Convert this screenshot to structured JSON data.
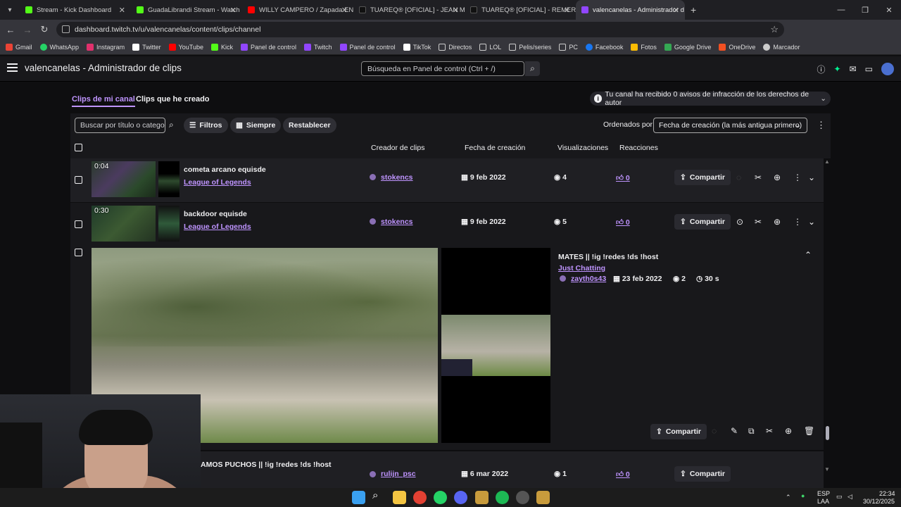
{
  "browser": {
    "tabs": [
      {
        "title": "Stream - Kick Dashboard",
        "color": "#53fc18"
      },
      {
        "title": "GuadaLibrandi Stream - Watch",
        "color": "#53fc18"
      },
      {
        "title": "WILLY CAMPERO / Zapada EN",
        "color": "#ff0000"
      },
      {
        "title": "TUAREQ® [OFICIAL] - JEAN M",
        "color": "#111111"
      },
      {
        "title": "TUAREQ® [OFICIAL] - REMERA",
        "color": "#111111"
      },
      {
        "title": "valencanelas - Administrador d",
        "color": "#9146ff"
      }
    ],
    "url": "dashboard.twitch.tv/u/valencanelas/content/clips/channel",
    "bookmarks": [
      {
        "label": "Gmail",
        "color": "#ea4335"
      },
      {
        "label": "WhatsApp",
        "color": "#25d366"
      },
      {
        "label": "Instagram",
        "color": "#e1306c"
      },
      {
        "label": "Twitter",
        "color": "#ffffff"
      },
      {
        "label": "YouTube",
        "color": "#ff0000"
      },
      {
        "label": "Kick",
        "color": "#53fc18"
      },
      {
        "label": "Panel de control",
        "color": "#9146ff"
      },
      {
        "label": "Twitch",
        "color": "#9146ff"
      },
      {
        "label": "Panel de control",
        "color": "#9146ff"
      },
      {
        "label": "TikTok",
        "color": "#ffffff"
      },
      {
        "label": "Directos",
        "color": "#cccccc"
      },
      {
        "label": "LOL",
        "color": "#cccccc"
      },
      {
        "label": "Pelis/series",
        "color": "#cccccc"
      },
      {
        "label": "PC",
        "color": "#cccccc"
      },
      {
        "label": "Facebook",
        "color": "#1877f2"
      },
      {
        "label": "Fotos",
        "color": "#fbbc04"
      },
      {
        "label": "Google Drive",
        "color": "#34a853"
      },
      {
        "label": "OneDrive",
        "color": "#0078d4"
      },
      {
        "label": "Marcador",
        "color": "#cccccc"
      }
    ]
  },
  "header": {
    "title": "valencanelas - Administrador de clips",
    "search_placeholder": "Búsqueda en Panel de control (Ctrl + /)"
  },
  "subtabs": {
    "mine": "Clips de mi canal",
    "created": "Clips que he creado"
  },
  "notice": "Tu canal ha recibido 0 avisos de infracción de los derechos de autor",
  "toolbar": {
    "filter_placeholder": "Buscar por título o categoría",
    "filters": "Filtros",
    "always": "Siempre",
    "reset": "Restablecer",
    "sort_label": "Ordenados por",
    "sort_value": "Fecha de creación (la más antigua primero)"
  },
  "columns": {
    "creator": "Creador de clips",
    "date": "Fecha de creación",
    "views": "Visualizaciones",
    "reactions": "Reacciones"
  },
  "clips": [
    {
      "duration": "0:04",
      "title": "cometa arcano equisde",
      "category": "League of Legends",
      "creator": "stokencs",
      "date": "9 feb 2022",
      "views": "4",
      "reactions": "0",
      "share": "Compartir"
    },
    {
      "duration": "0:30",
      "title": "backdoor equisde",
      "category": "League of Legends",
      "creator": "stokencs",
      "date": "9 feb 2022",
      "views": "5",
      "reactions": "0",
      "share": "Compartir"
    }
  ],
  "expanded": {
    "title": "MATES || !ig !redes !ds !host",
    "category": "Just Chatting",
    "creator": "zayth0s43",
    "date": "23 feb 2022",
    "views": "2",
    "length": "30 s",
    "share": "Compartir"
  },
  "partial": {
    "title": "AMOS PUCHOS || !ig !redes !ds !host",
    "creator": "rulijn_psc",
    "date": "6 mar 2022",
    "views": "1",
    "reactions": "0",
    "share": "Compartir"
  },
  "taskbar": {
    "lang1": "ESP",
    "lang2": "LAA",
    "time": "22:34",
    "date": "30/12/2025"
  }
}
